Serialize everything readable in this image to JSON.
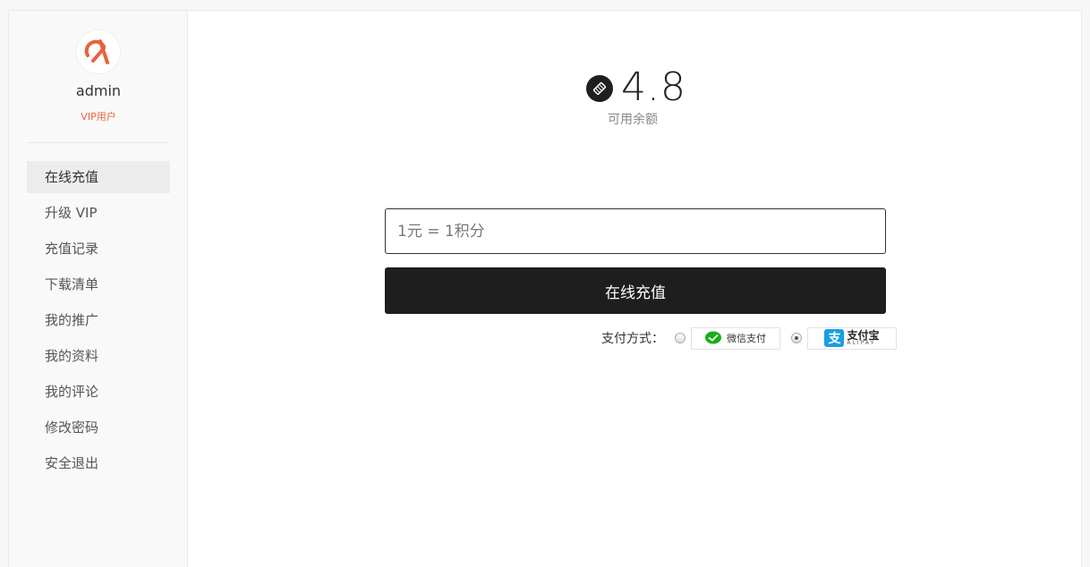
{
  "user": {
    "name": "admin",
    "type": "VIP用户"
  },
  "sidebar": {
    "items": [
      {
        "label": "在线充值"
      },
      {
        "label": "升级 VIP"
      },
      {
        "label": "充值记录"
      },
      {
        "label": "下载清单"
      },
      {
        "label": "我的推广"
      },
      {
        "label": "我的资料"
      },
      {
        "label": "我的评论"
      },
      {
        "label": "修改密码"
      },
      {
        "label": "安全退出"
      }
    ],
    "active_index": 0
  },
  "balance": {
    "amount": "4.8",
    "label": "可用余额"
  },
  "recharge": {
    "placeholder": "1元 = 1积分",
    "button_label": "在线充值",
    "pay_methods_label": "支付方式：",
    "methods": [
      {
        "name": "wechat",
        "label": "微信支付",
        "selected": false
      },
      {
        "name": "alipay",
        "label": "支付宝",
        "sublabel": "ALIPAY",
        "selected": true
      }
    ]
  },
  "colors": {
    "accent": "#e8623b",
    "button": "#1e1e1e",
    "wechat_green": "#1aad19",
    "alipay_blue": "#1a9fe0"
  }
}
